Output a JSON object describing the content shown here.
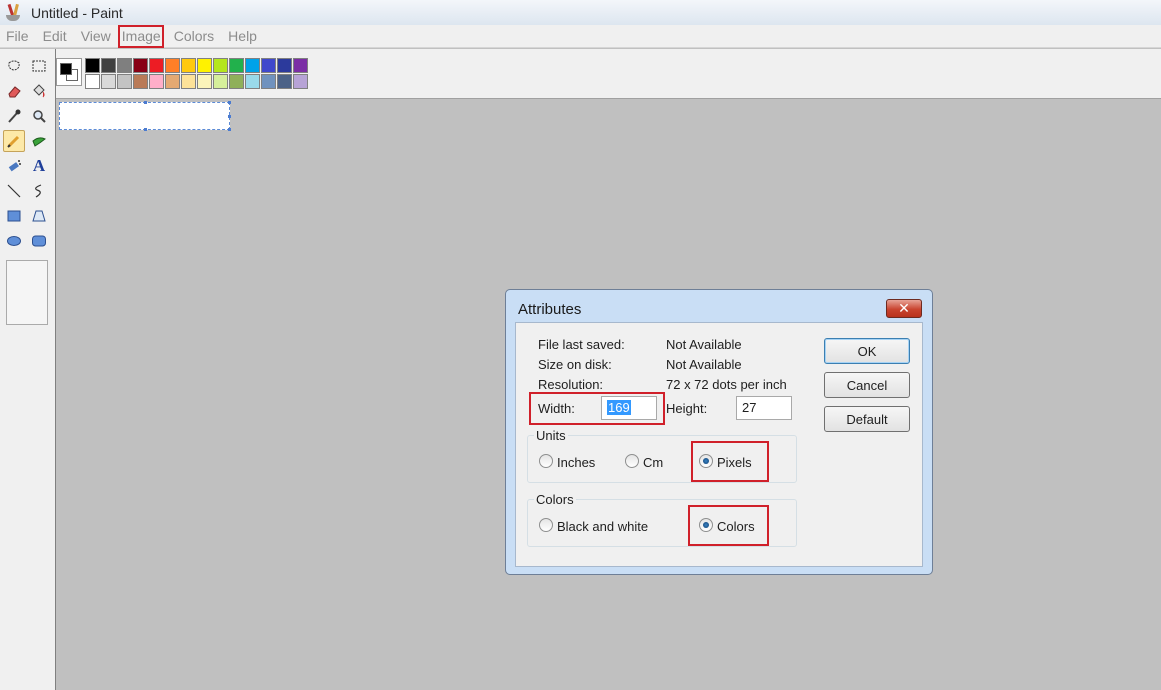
{
  "window": {
    "title": "Untitled - Paint"
  },
  "menu": {
    "items": [
      "File",
      "Edit",
      "View",
      "Image",
      "Colors",
      "Help"
    ]
  },
  "palette": {
    "row1": [
      "#000000",
      "#404040",
      "#7f7f7f",
      "#880015",
      "#ed1c24",
      "#ff7f27",
      "#ffc90e",
      "#fff200",
      "#b5e61d",
      "#22b14c",
      "#00a2e8",
      "#3f48cc",
      "#2c3a9c",
      "#7b2ea5"
    ],
    "row2": [
      "#ffffff",
      "#d9d9d9",
      "#c3c3c3",
      "#b97a57",
      "#ffaec9",
      "#e4a972",
      "#fde298",
      "#fbf4ba",
      "#d6ef9b",
      "#8fb05a",
      "#99d9ea",
      "#7092be",
      "#4c6287",
      "#b7a3d6"
    ]
  },
  "dialog": {
    "title": "Attributes",
    "close_glyph": "✕",
    "file_last_saved_label": "File last saved:",
    "file_last_saved_value": "Not Available",
    "size_on_disk_label": "Size on disk:",
    "size_on_disk_value": "Not Available",
    "resolution_label": "Resolution:",
    "resolution_value": "72 x 72 dots per inch",
    "width_label": "Width:",
    "width_value": "169",
    "height_label": "Height:",
    "height_value": "27",
    "units": {
      "title": "Units",
      "options": [
        "Inches",
        "Cm",
        "Pixels"
      ],
      "selected": "Pixels"
    },
    "colors": {
      "title": "Colors",
      "options": [
        "Black and white",
        "Colors"
      ],
      "selected": "Colors"
    },
    "buttons": {
      "ok": "OK",
      "cancel": "Cancel",
      "default": "Default"
    }
  },
  "highlight_color": "#d0202a"
}
